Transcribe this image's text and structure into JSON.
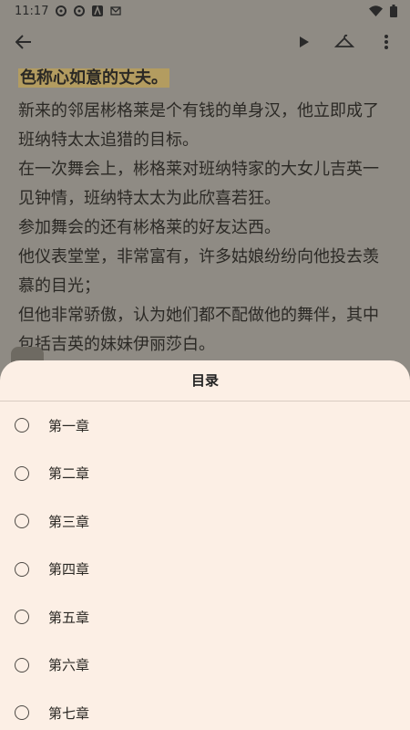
{
  "status_bar": {
    "time": "11:17",
    "left_icons": [
      "settings-icon",
      "settings-icon",
      "a-icon",
      "mail-icon"
    ],
    "right_icons": [
      "wifi-icon",
      "battery-icon"
    ]
  },
  "toolbar": {
    "back_icon": "arrow-left-icon",
    "play_icon": "play-icon",
    "hanger_icon": "hanger-icon",
    "more_icon": "more-vertical-icon"
  },
  "reader": {
    "highlight_line": "色称心如意的丈夫。",
    "paragraphs": [
      " 新来的邻居彬格莱是个有钱的单身汉，他立即成了班纳特太太追猎的目标。",
      "在一次舞会上，彬格莱对班纳特家的大女儿吉英一见钟情，班纳特太太为此欣喜若狂。",
      " 参加舞会的还有彬格莱的好友达西。",
      "他仪表堂堂，非常富有，许多姑娘纷纷向他投去羡慕的目光；",
      "但他非常骄傲，认为她们都不配做他的舞伴，其中包括吉英的妹妹伊丽莎白。"
    ]
  },
  "toc": {
    "title": "目录",
    "chapters": [
      "第一章",
      "第二章",
      "第三章",
      "第四章",
      "第五章",
      "第六章",
      "第七章"
    ]
  },
  "colors": {
    "sheet_bg": "#fcefe5",
    "dim_overlay": "#8f8b84",
    "highlight": "#b39c60"
  }
}
